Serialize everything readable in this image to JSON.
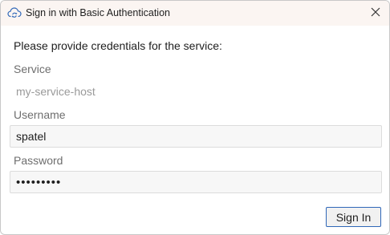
{
  "window": {
    "title": "Sign in with Basic Authentication",
    "icon": "cloud-sync-icon",
    "close_icon": "close-icon"
  },
  "form": {
    "prompt": "Please provide credentials for the service:",
    "service_label": "Service",
    "service_value": "my-service-host",
    "username_label": "Username",
    "username_value": "spatel",
    "password_label": "Password",
    "password_value": "•••••••••"
  },
  "actions": {
    "sign_in_label": "Sign In"
  },
  "colors": {
    "titlebar_bg": "#fbf5f2",
    "button_border": "#2f67b8",
    "field_bg": "#f7f7f7"
  }
}
